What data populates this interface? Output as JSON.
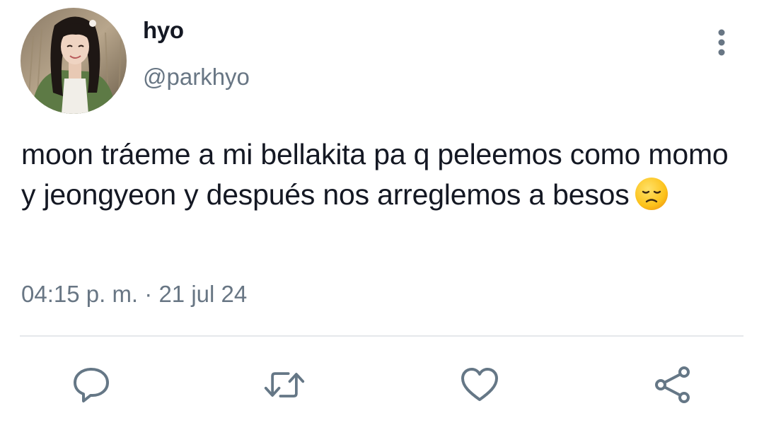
{
  "user": {
    "display_name": "hyo",
    "handle": "@parkhyo",
    "avatar_icon": "profile-photo"
  },
  "tweet": {
    "text": "moon tráeme a mi bellakita pa q peleemos como momo y jeongyeon y después nos arreglemos a besos",
    "emoji": "disappointed-face",
    "time": "04:15 p. m.",
    "separator": "·",
    "date": "21 jul 24"
  },
  "actions": [
    {
      "name": "reply",
      "icon": "comment-bubble-icon"
    },
    {
      "name": "retweet",
      "icon": "retweet-icon"
    },
    {
      "name": "like",
      "icon": "heart-icon"
    },
    {
      "name": "share",
      "icon": "share-icon"
    }
  ],
  "colors": {
    "text_primary": "#141823",
    "text_secondary": "#687684",
    "divider": "#e5e8eb",
    "icon": "#657786"
  }
}
